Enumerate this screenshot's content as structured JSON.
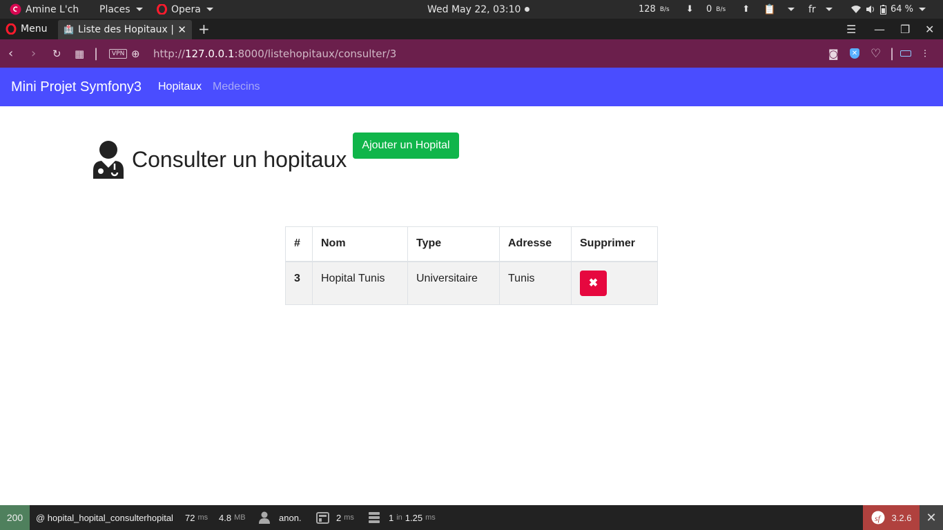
{
  "system": {
    "user": "Amine L'ch",
    "places": "Places",
    "app": "Opera",
    "clock": "Wed May 22, 03:10",
    "net_down": "128",
    "net_down_unit": "B/s",
    "net_up": "0",
    "net_up_unit": "B/s",
    "lang": "fr",
    "battery": "64 %"
  },
  "browser": {
    "menu_label": "Menu",
    "tab_title": "Liste des Hopitaux | mini",
    "url_prefix": "http://",
    "url_host": "127.0.0.1",
    "url_path": ":8000/listehopitaux/consulter/3",
    "vpn_label": "VPN"
  },
  "navbar": {
    "brand": "Mini Projet Symfony3",
    "links": [
      {
        "label": "Hopitaux",
        "active": true
      },
      {
        "label": "Medecins",
        "active": false
      }
    ]
  },
  "main": {
    "title": "Consulter un hopitaux",
    "add_button": "Ajouter un Hopital",
    "table": {
      "headers": [
        "#",
        "Nom",
        "Type",
        "Adresse",
        "Supprimer"
      ],
      "rows": [
        {
          "id": "3",
          "nom": "Hopital Tunis",
          "type": "Universitaire",
          "adresse": "Tunis",
          "delete_icon": "✖"
        }
      ]
    }
  },
  "profiler": {
    "status": "200",
    "route": "@ hopital_hopital_consulterhopital",
    "time": "72",
    "time_unit": "ms",
    "memory": "4.8",
    "memory_unit": "MB",
    "user": "anon.",
    "twig": "2",
    "twig_unit": "ms",
    "db_count": "1",
    "db_in": "in",
    "db_time": "1.25",
    "db_unit": "ms",
    "version": "3.2.6"
  },
  "colors": {
    "navbar": "#4a4dff",
    "add_button": "#10b54a",
    "delete_button": "#e6083f",
    "addressbar": "#6b1f4c"
  }
}
